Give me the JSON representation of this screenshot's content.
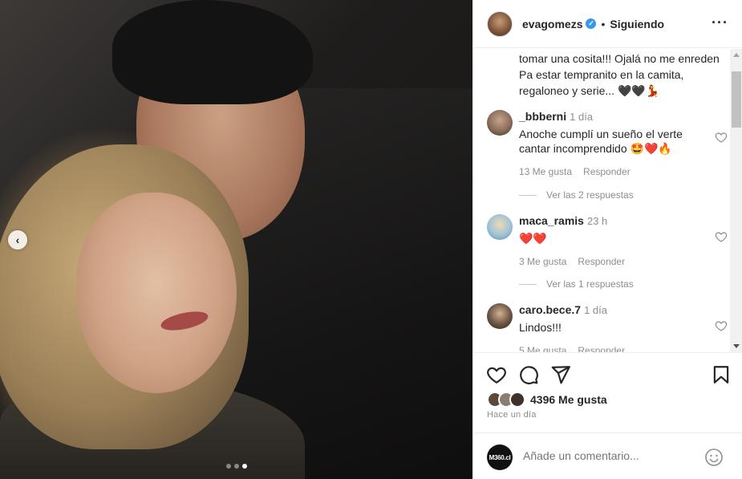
{
  "post": {
    "carousel_prev_glyph": "‹",
    "slides": [
      false,
      false,
      true
    ]
  },
  "header": {
    "username": "evagomezs",
    "verified_glyph": "✓",
    "separator": "•",
    "follow_status": "Siguiendo",
    "more_glyph": "···"
  },
  "caption_tail": "tomar una cosita!!! Ojalá no me enreden Pa estar tempranito en la camita, regaloneo y serie... 🖤🖤💃",
  "comments": [
    {
      "user": "_bbberni",
      "time": "1 día",
      "text": "Anoche cumplí un sueño el verte cantar incomprendido 🤩❤️🔥",
      "likes": "13 Me gusta",
      "reply_label": "Responder",
      "replies": "Ver las 2 respuestas",
      "avatar_color": "#8a6d5a"
    },
    {
      "user": "maca_ramis",
      "time": "23 h",
      "text": "❤️❤️",
      "likes": "3 Me gusta",
      "reply_label": "Responder",
      "replies": "Ver las 1 respuestas",
      "avatar_color": "#9ec3d6"
    },
    {
      "user": "caro.bece.7",
      "time": "1 día",
      "text": "Lindos!!!",
      "likes": "5 Me gusta",
      "reply_label": "Responder",
      "replies": "",
      "avatar_color": "#6b5443"
    }
  ],
  "actions": {
    "likes_count": "4396 Me gusta",
    "date": "Hace un día"
  },
  "add_comment": {
    "account_badge": "M360.cl",
    "placeholder": "Añade un comentario..."
  },
  "colors": {
    "verified": "#3897f0",
    "secondary_text": "#8e8e8e",
    "primary_text": "#262626"
  }
}
